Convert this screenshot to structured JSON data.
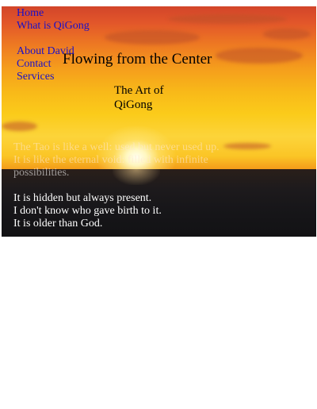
{
  "nav": {
    "items": [
      "Home",
      "What is QiGong",
      "About David",
      "Contact",
      "Services"
    ]
  },
  "header": {
    "title": "Flowing from the Center",
    "subtitle": "The Art of QiGong"
  },
  "content": {
    "paragraph1_lines": [
      "The Tao is like a well: used but never used up.",
      "It is like the eternal void: filled with infinite",
      "possibilities."
    ],
    "paragraph2_lines": [
      "It is hidden but always present.",
      "I don't know who gave birth to it.",
      "It is older than God."
    ]
  },
  "colors": {
    "link": "#1a10c8",
    "page_background": "#ffffff"
  }
}
